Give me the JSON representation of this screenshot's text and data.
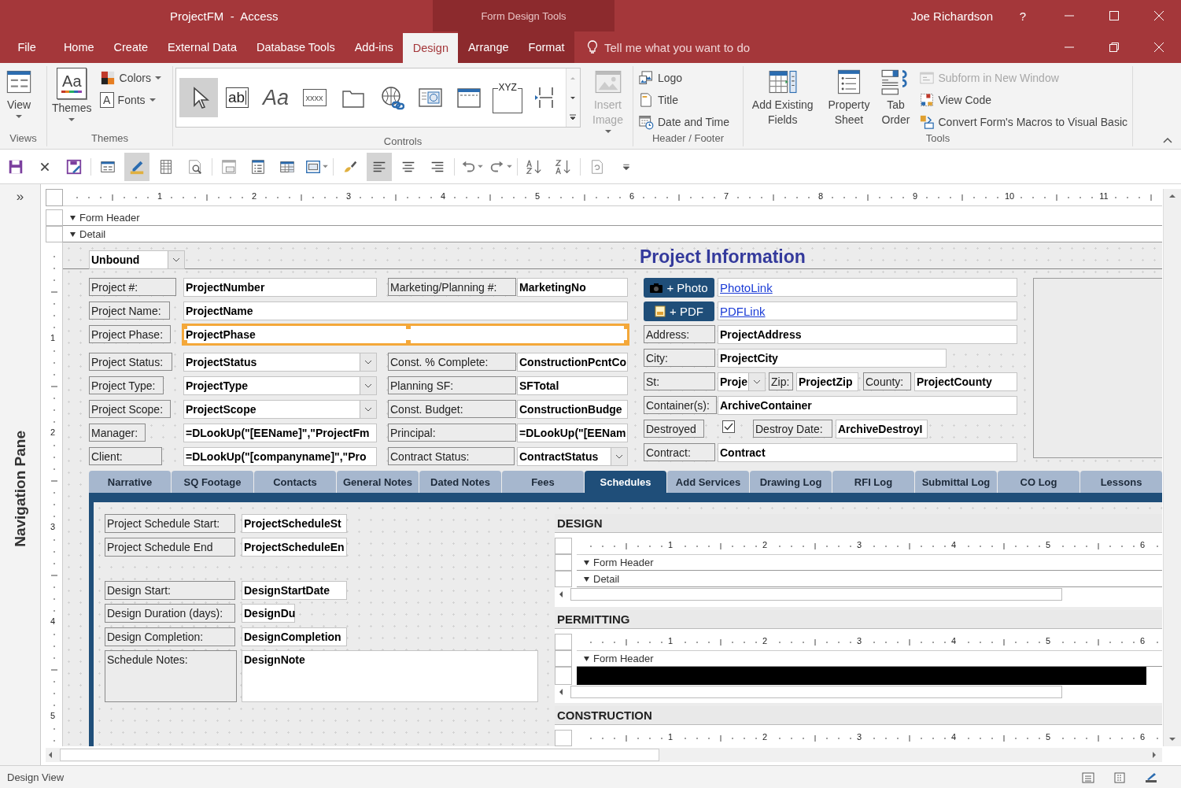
{
  "window": {
    "title": "ProjectFM  -  Access",
    "context_title": "Form Design Tools",
    "user": "Joe Richardson",
    "help": "?"
  },
  "ribbon_tabs": [
    {
      "label": "File",
      "selected": false,
      "contextual": false
    },
    {
      "label": "Home",
      "selected": false,
      "contextual": false
    },
    {
      "label": "Create",
      "selected": false,
      "contextual": false
    },
    {
      "label": "External Data",
      "selected": false,
      "contextual": false
    },
    {
      "label": "Database Tools",
      "selected": false,
      "contextual": false
    },
    {
      "label": "Add-ins",
      "selected": false,
      "contextual": false
    },
    {
      "label": "Design",
      "selected": true,
      "contextual": true
    },
    {
      "label": "Arrange",
      "selected": false,
      "contextual": true
    },
    {
      "label": "Format",
      "selected": false,
      "contextual": true
    }
  ],
  "tell_me": {
    "placeholder": "Tell me what you want to do"
  },
  "ribbon": {
    "groups": [
      {
        "label": "Views",
        "items": [
          {
            "kind": "view",
            "label": "View",
            "dropdown": true,
            "disabled": false
          }
        ]
      },
      {
        "label": "Themes",
        "items": [
          {
            "kind": "themes",
            "label": "Themes",
            "glyph": "Aa",
            "dropdown": true,
            "disabled": false
          },
          {
            "kind": "colors",
            "label": "Colors",
            "dropdown": true,
            "disabled": false
          },
          {
            "kind": "fonts",
            "label": "Fonts",
            "glyph": "A",
            "dropdown": true,
            "disabled": false
          }
        ]
      },
      {
        "label": "Controls",
        "gallery": [
          {
            "kind": "select",
            "selected": true
          },
          {
            "kind": "textbox",
            "glyph": "ab",
            "selected": false
          },
          {
            "kind": "label",
            "glyph": "Aa",
            "selected": false
          },
          {
            "kind": "button",
            "glyph": "xxxx",
            "selected": false
          },
          {
            "kind": "tab",
            "selected": false
          },
          {
            "kind": "hyperlink",
            "selected": false
          },
          {
            "kind": "browser",
            "selected": false
          },
          {
            "kind": "navigation",
            "selected": false
          },
          {
            "kind": "optiongroup",
            "glyph": "XYZ",
            "selected": false
          },
          {
            "kind": "pagebreak",
            "selected": false
          }
        ],
        "items": [
          {
            "kind": "image",
            "label": "Insert Image",
            "dropdown": true,
            "disabled": true
          }
        ]
      },
      {
        "label": "Header / Footer",
        "items": [
          {
            "kind": "logo",
            "label": "Logo",
            "dropdown": false,
            "disabled": false
          },
          {
            "kind": "title",
            "label": "Title",
            "dropdown": false,
            "disabled": false
          },
          {
            "kind": "datetime",
            "label": "Date and Time",
            "dropdown": false,
            "disabled": false
          }
        ]
      },
      {
        "label": "Tools",
        "items": [
          {
            "kind": "fields",
            "label": "Add Existing Fields",
            "dropdown": false,
            "disabled": false
          },
          {
            "kind": "property",
            "label": "Property Sheet",
            "dropdown": false,
            "disabled": false
          },
          {
            "kind": "taborder",
            "label": "Tab Order",
            "dropdown": false,
            "disabled": false
          },
          {
            "kind": "subform",
            "label": "Subform in New Window",
            "dropdown": false,
            "disabled": true
          },
          {
            "kind": "code",
            "label": "View Code",
            "dropdown": false,
            "disabled": false
          },
          {
            "kind": "convert",
            "label": "Convert Form's Macros to Visual Basic",
            "dropdown": false,
            "disabled": false
          }
        ]
      }
    ]
  },
  "quick_access": [
    {
      "kind": "save",
      "selected": false,
      "dropdown": false
    },
    {
      "kind": "close",
      "selected": false,
      "dropdown": false
    },
    {
      "kind": "saveas",
      "selected": false,
      "dropdown": false
    },
    {
      "kind": "form",
      "selected": false,
      "dropdown": false
    },
    {
      "kind": "design",
      "selected": true,
      "dropdown": false
    },
    {
      "kind": "datasheet",
      "selected": false,
      "dropdown": false
    },
    {
      "kind": "preview",
      "selected": false,
      "dropdown": false
    },
    {
      "kind": "subform",
      "selected": false,
      "dropdown": false
    },
    {
      "kind": "list",
      "selected": false,
      "dropdown": false
    },
    {
      "kind": "table",
      "selected": false,
      "dropdown": false
    },
    {
      "kind": "layout",
      "selected": false,
      "dropdown": true
    },
    {
      "kind": "brush",
      "selected": false,
      "dropdown": false
    },
    {
      "kind": "alignleft",
      "selected": true,
      "dropdown": false
    },
    {
      "kind": "aligncenter",
      "selected": false,
      "dropdown": false
    },
    {
      "kind": "alignright",
      "selected": false,
      "dropdown": false
    },
    {
      "kind": "undo",
      "selected": false,
      "dropdown": true
    },
    {
      "kind": "redo",
      "selected": false,
      "dropdown": true
    },
    {
      "kind": "sortasc",
      "selected": false,
      "dropdown": false
    },
    {
      "kind": "sortdesc",
      "selected": false,
      "dropdown": false
    },
    {
      "kind": "refresh",
      "selected": false,
      "dropdown": false
    },
    {
      "kind": "more",
      "selected": false,
      "dropdown": false
    }
  ],
  "navigation_pane": {
    "toggle": "»",
    "title": "Navigation Pane"
  },
  "form": {
    "ruler_marks": [
      "1",
      "2",
      "3",
      "4",
      "5",
      "6",
      "7",
      "8",
      "9",
      "10",
      "11"
    ],
    "vertical_ruler_marks": [
      "1",
      "2",
      "3",
      "4",
      "5"
    ],
    "sections": [
      {
        "label": "Form Header"
      },
      {
        "label": "Detail"
      }
    ],
    "controls": [
      {
        "kind": "combo",
        "text": "Unbound",
        "selected": false
      },
      {
        "kind": "heading",
        "text": "Project Information",
        "selected": false
      },
      {
        "kind": "label",
        "text": "Project #:",
        "selected": false
      },
      {
        "kind": "textbox",
        "text": "ProjectNumber",
        "selected": false
      },
      {
        "kind": "label",
        "text": "Marketing/Planning #:",
        "selected": false
      },
      {
        "kind": "textbox",
        "text": "MarketingNo",
        "selected": false
      },
      {
        "kind": "photobutton",
        "text": "+ Photo",
        "selected": false
      },
      {
        "kind": "link",
        "text": "PhotoLink",
        "selected": false
      },
      {
        "kind": "frame",
        "selected": false
      },
      {
        "kind": "label",
        "text": "Project Name:",
        "selected": false
      },
      {
        "kind": "textbox",
        "text": "ProjectName",
        "selected": false
      },
      {
        "kind": "pdfbutton",
        "text": "+ PDF",
        "selected": false
      },
      {
        "kind": "link",
        "text": "PDFLink",
        "selected": false
      },
      {
        "kind": "label",
        "text": "Project Phase:",
        "selected": false
      },
      {
        "kind": "textbox",
        "text": "ProjectPhase",
        "selected": true
      },
      {
        "kind": "label",
        "text": "Address:",
        "selected": false
      },
      {
        "kind": "textbox",
        "text": "ProjectAddress",
        "selected": false
      },
      {
        "kind": "label",
        "text": "Project Status:",
        "selected": false
      },
      {
        "kind": "combo",
        "text": "ProjectStatus",
        "selected": false
      },
      {
        "kind": "label",
        "text": "Const. % Complete:",
        "selected": false
      },
      {
        "kind": "textbox",
        "text": "ConstructionPcntCo",
        "selected": false
      },
      {
        "kind": "label",
        "text": "City:",
        "selected": false
      },
      {
        "kind": "textbox",
        "text": "ProjectCity",
        "selected": false
      },
      {
        "kind": "label",
        "text": "Project Type:",
        "selected": false
      },
      {
        "kind": "combo",
        "text": "ProjectType",
        "selected": false
      },
      {
        "kind": "label",
        "text": "Planning SF:",
        "selected": false
      },
      {
        "kind": "textbox",
        "text": "SFTotal",
        "selected": false
      },
      {
        "kind": "label",
        "text": "St:",
        "selected": false
      },
      {
        "kind": "combo",
        "text": "Proje",
        "selected": false
      },
      {
        "kind": "label",
        "text": "Zip:",
        "selected": false
      },
      {
        "kind": "textbox",
        "text": "ProjectZip",
        "selected": false
      },
      {
        "kind": "label",
        "text": "County:",
        "selected": false
      },
      {
        "kind": "textbox",
        "text": "ProjectCounty",
        "selected": false
      },
      {
        "kind": "label",
        "text": "Project Scope:",
        "selected": false
      },
      {
        "kind": "combo",
        "text": "ProjectScope",
        "selected": false
      },
      {
        "kind": "label",
        "text": "Const. Budget:",
        "selected": false
      },
      {
        "kind": "textbox",
        "text": "ConstructionBudge",
        "selected": false
      },
      {
        "kind": "label",
        "text": "Container(s):",
        "selected": false
      },
      {
        "kind": "textbox",
        "text": "ArchiveContainer",
        "selected": false
      },
      {
        "kind": "label",
        "text": "Manager:",
        "selected": false
      },
      {
        "kind": "textbox",
        "text": "=DLookUp(\"[EEName]\",\"ProjectFm",
        "selected": false
      },
      {
        "kind": "label",
        "text": "Principal:",
        "selected": false
      },
      {
        "kind": "textbox",
        "text": "=DLookUp(\"[EENam",
        "selected": false
      },
      {
        "kind": "label",
        "text": "Destroyed",
        "selected": false
      },
      {
        "kind": "checkbox",
        "checked": true
      },
      {
        "kind": "label",
        "text": "Destroy Date:",
        "selected": false
      },
      {
        "kind": "textbox",
        "text": "ArchiveDestroyI",
        "selected": false
      },
      {
        "kind": "label",
        "text": "Client:",
        "selected": false
      },
      {
        "kind": "textbox",
        "text": "=DLookUp(\"[companyname]\",\"Pro",
        "selected": false
      },
      {
        "kind": "label",
        "text": "Contract Status:",
        "selected": false
      },
      {
        "kind": "combo",
        "text": "ContractStatus",
        "selected": false
      },
      {
        "kind": "label",
        "text": "Contract:",
        "selected": false
      },
      {
        "kind": "textbox",
        "text": "Contract",
        "selected": false
      }
    ],
    "tabs": [
      {
        "label": "Narrative",
        "selected": false
      },
      {
        "label": "SQ Footage",
        "selected": false
      },
      {
        "label": "Contacts",
        "selected": false
      },
      {
        "label": "General Notes",
        "selected": false
      },
      {
        "label": "Dated Notes",
        "selected": false
      },
      {
        "label": "Fees",
        "selected": false
      },
      {
        "label": "Schedules",
        "selected": true
      },
      {
        "label": "Add Services",
        "selected": false
      },
      {
        "label": "Drawing Log",
        "selected": false
      },
      {
        "label": "RFI Log",
        "selected": false
      },
      {
        "label": "Submittal Log",
        "selected": false
      },
      {
        "label": "CO Log",
        "selected": false
      },
      {
        "label": "Lessons",
        "selected": false
      }
    ],
    "page_controls": [
      {
        "kind": "label",
        "text": "Project Schedule Start:",
        "selected": false
      },
      {
        "kind": "textbox",
        "text": "ProjectScheduleSt",
        "selected": false
      },
      {
        "kind": "label",
        "text": "Project Schedule End",
        "selected": false
      },
      {
        "kind": "textbox",
        "text": "ProjectScheduleEn",
        "selected": false
      },
      {
        "kind": "label",
        "text": "Design Start:",
        "selected": false
      },
      {
        "kind": "textbox",
        "text": "DesignStartDate",
        "selected": false
      },
      {
        "kind": "label",
        "text": "Design Duration (days):",
        "selected": false
      },
      {
        "kind": "textbox",
        "text": "DesignDu",
        "selected": false
      },
      {
        "kind": "label",
        "text": "Design Completion:",
        "selected": false
      },
      {
        "kind": "textbox",
        "text": "DesignCompletion",
        "selected": false
      },
      {
        "kind": "label",
        "text": "Schedule Notes:",
        "selected": false
      },
      {
        "kind": "textbox",
        "text": "DesignNote",
        "selected": false
      }
    ],
    "subforms": [
      {
        "title": "DESIGN",
        "ruler_marks": [
          "1",
          "2",
          "3",
          "4",
          "5",
          "6"
        ],
        "sections": [
          {
            "label": "Form Header"
          },
          {
            "label": "Detail"
          }
        ],
        "detail_bar_selected": false
      },
      {
        "title": "PERMITTING",
        "ruler_marks": [
          "1",
          "2",
          "3",
          "4",
          "5",
          "6"
        ],
        "sections": [
          {
            "label": "Form Header"
          }
        ],
        "detail_bar_selected": true
      },
      {
        "title": "CONSTRUCTION",
        "ruler_marks": [
          "1",
          "2",
          "3",
          "4",
          "5",
          "6"
        ],
        "detail_bar_selected": false
      }
    ]
  },
  "status_bar": {
    "text": "Design View"
  }
}
